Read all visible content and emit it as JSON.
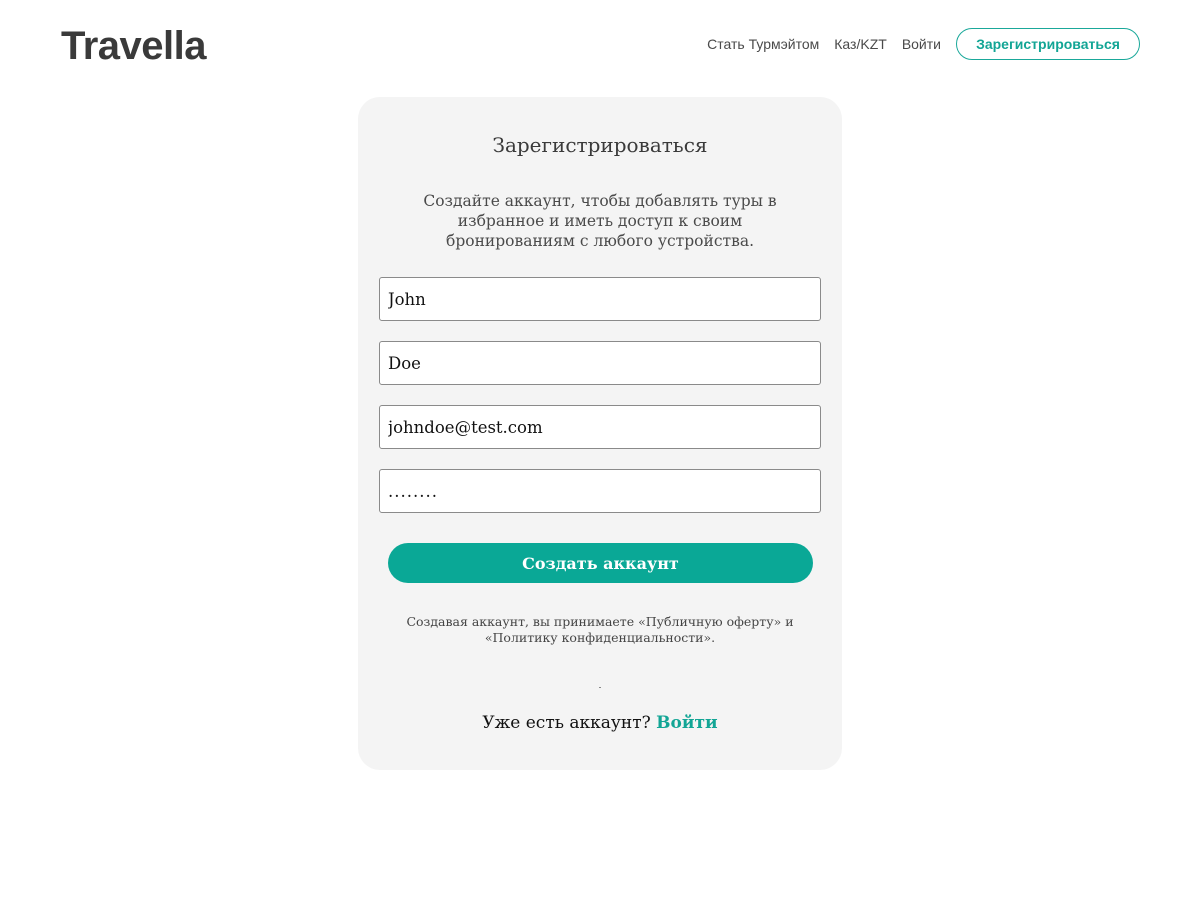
{
  "header": {
    "logo": "Travella",
    "nav": {
      "become_tourmate": "Стать Турмэйтом",
      "currency": "Каз/KZT",
      "login": "Войти",
      "signup": "Зарегистрироваться"
    }
  },
  "form": {
    "title": "Зарегистрироваться",
    "subtitle": "Создайте аккаунт, чтобы добавлять туры в избранное и иметь доступ к своим бронированиям с любого устройства.",
    "first_name": "John",
    "last_name": "Doe",
    "email": "johndoe@test.com",
    "password": "........",
    "submit_label": "Создать аккаунт",
    "terms": "Создавая аккаунт, вы принимаете «Публичную оферту» и «Политику конфиденциальности».",
    "have_account": "Уже есть аккаунт?",
    "login_link": "Войти"
  },
  "colors": {
    "accent": "#0aa896",
    "card_bg": "#f4f4f4"
  }
}
